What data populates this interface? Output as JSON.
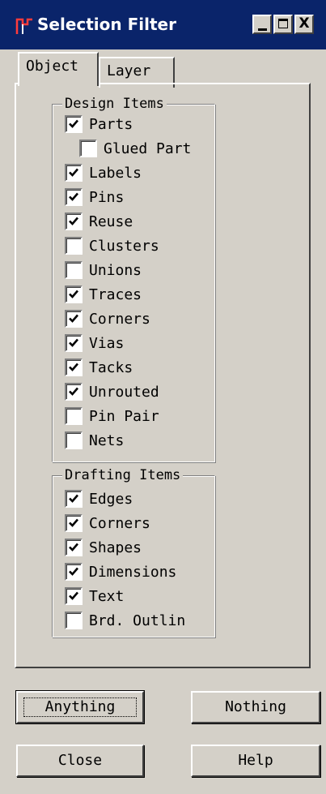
{
  "window": {
    "title": "Selection Filter",
    "controls": {
      "minimize": "_",
      "maximize": "□",
      "close": "X"
    }
  },
  "tabs": [
    {
      "label": "Object",
      "active": true
    },
    {
      "label": "Layer",
      "active": false
    }
  ],
  "design_items": {
    "legend": "Design Items",
    "items": [
      {
        "label": "Parts",
        "checked": true
      },
      {
        "label": "Glued Part",
        "checked": false,
        "indent": true
      },
      {
        "label": "Labels",
        "checked": true
      },
      {
        "label": "Pins",
        "checked": true
      },
      {
        "label": "Reuse",
        "checked": true
      },
      {
        "label": "Clusters",
        "checked": false
      },
      {
        "label": "Unions",
        "checked": false
      },
      {
        "label": "Traces",
        "checked": true
      },
      {
        "label": "Corners",
        "checked": true
      },
      {
        "label": "Vias",
        "checked": true
      },
      {
        "label": "Tacks",
        "checked": true
      },
      {
        "label": "Unrouted",
        "checked": true
      },
      {
        "label": "Pin Pair",
        "checked": false
      },
      {
        "label": "Nets",
        "checked": false
      }
    ]
  },
  "drafting_items": {
    "legend": "Drafting Items",
    "items": [
      {
        "label": "Edges",
        "checked": true
      },
      {
        "label": "Corners",
        "checked": true
      },
      {
        "label": "Shapes",
        "checked": true
      },
      {
        "label": "Dimensions",
        "checked": true
      },
      {
        "label": "Text",
        "checked": true
      },
      {
        "label": "Brd. Outlin",
        "checked": false
      }
    ]
  },
  "buttons": {
    "anything": "Anything",
    "nothing": "Nothing",
    "close": "Close",
    "help": "Help"
  },
  "colors": {
    "titlebar": "#0a246a",
    "face": "#d4d0c8",
    "icon": "#ff2a2a"
  }
}
